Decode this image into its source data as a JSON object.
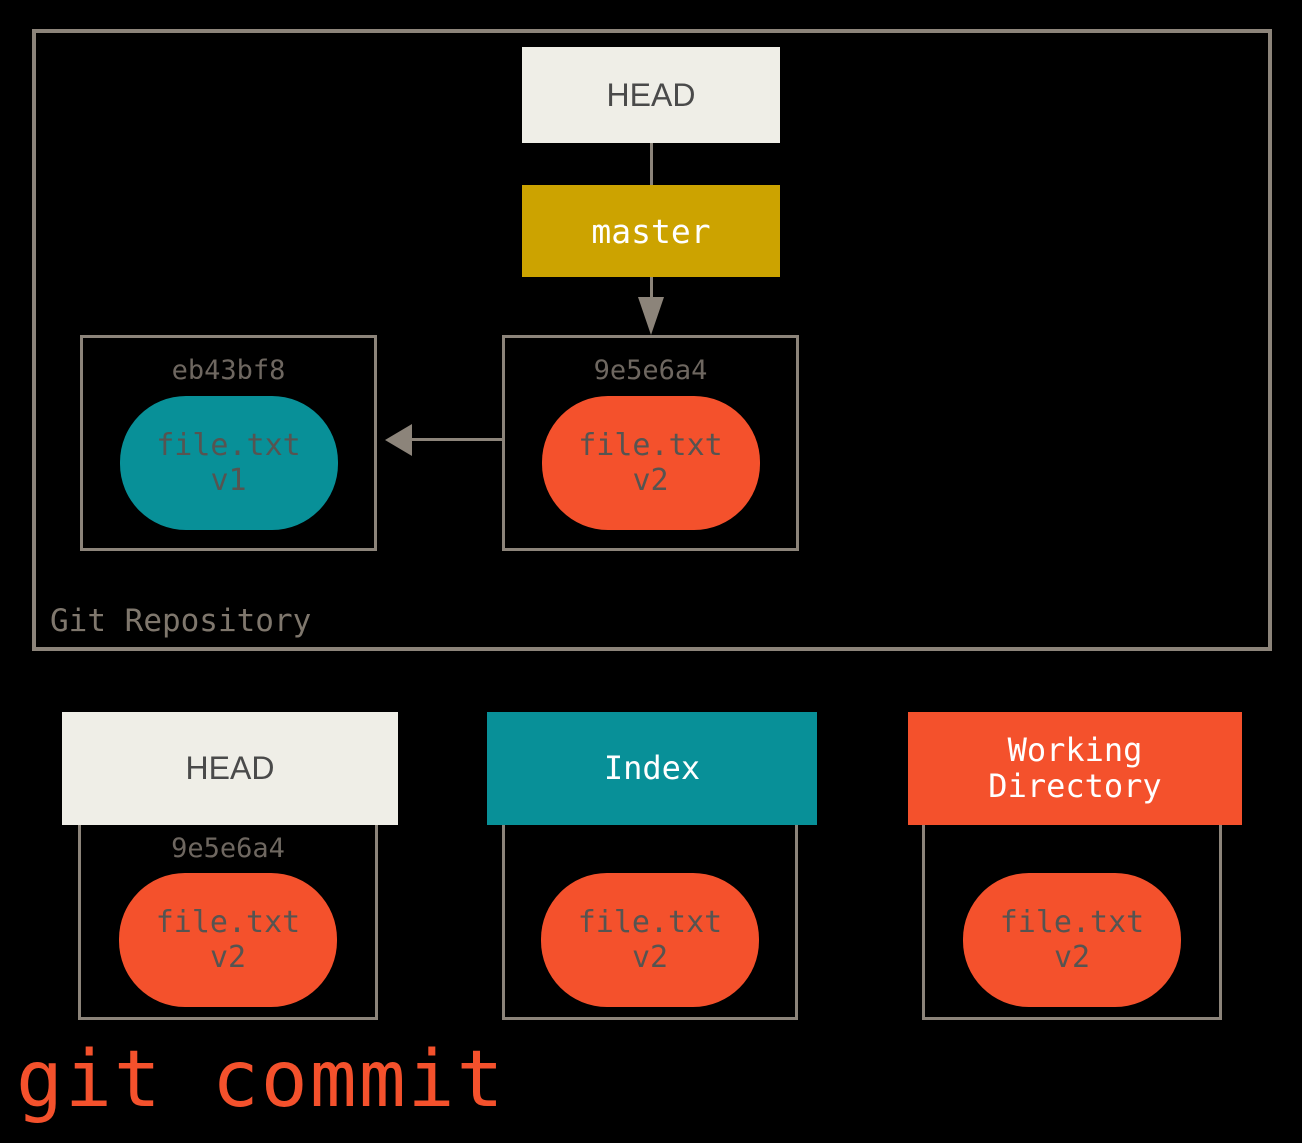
{
  "diagram": {
    "caption": "git commit",
    "repository": {
      "label": "Git Repository",
      "head_pointer": "HEAD",
      "branch": "master",
      "commits": [
        {
          "hash": "eb43bf8",
          "file": "file.txt",
          "version": "v1",
          "color": "#089098"
        },
        {
          "hash": "9e5e6a4",
          "file": "file.txt",
          "version": "v2",
          "color": "#f4512c"
        }
      ]
    },
    "areas": [
      {
        "title": "HEAD",
        "title_line2": "",
        "hash": "9e5e6a4",
        "file": "file.txt",
        "version": "v2",
        "header_color": "#efeee7",
        "blob_color": "#f4512c"
      },
      {
        "title": "Index",
        "title_line2": "",
        "hash": "",
        "file": "file.txt",
        "version": "v2",
        "header_color": "#089098",
        "blob_color": "#f4512c"
      },
      {
        "title": "Working",
        "title_line2": "Directory",
        "hash": "",
        "file": "file.txt",
        "version": "v2",
        "header_color": "#f4512c",
        "blob_color": "#f4512c"
      }
    ],
    "colors": {
      "background": "#000000",
      "border_gray": "#8c847a",
      "text_gray": "#6e6760",
      "cream": "#efeee7",
      "gold": "#cca300",
      "teal": "#089098",
      "orange": "#f4512c"
    }
  }
}
